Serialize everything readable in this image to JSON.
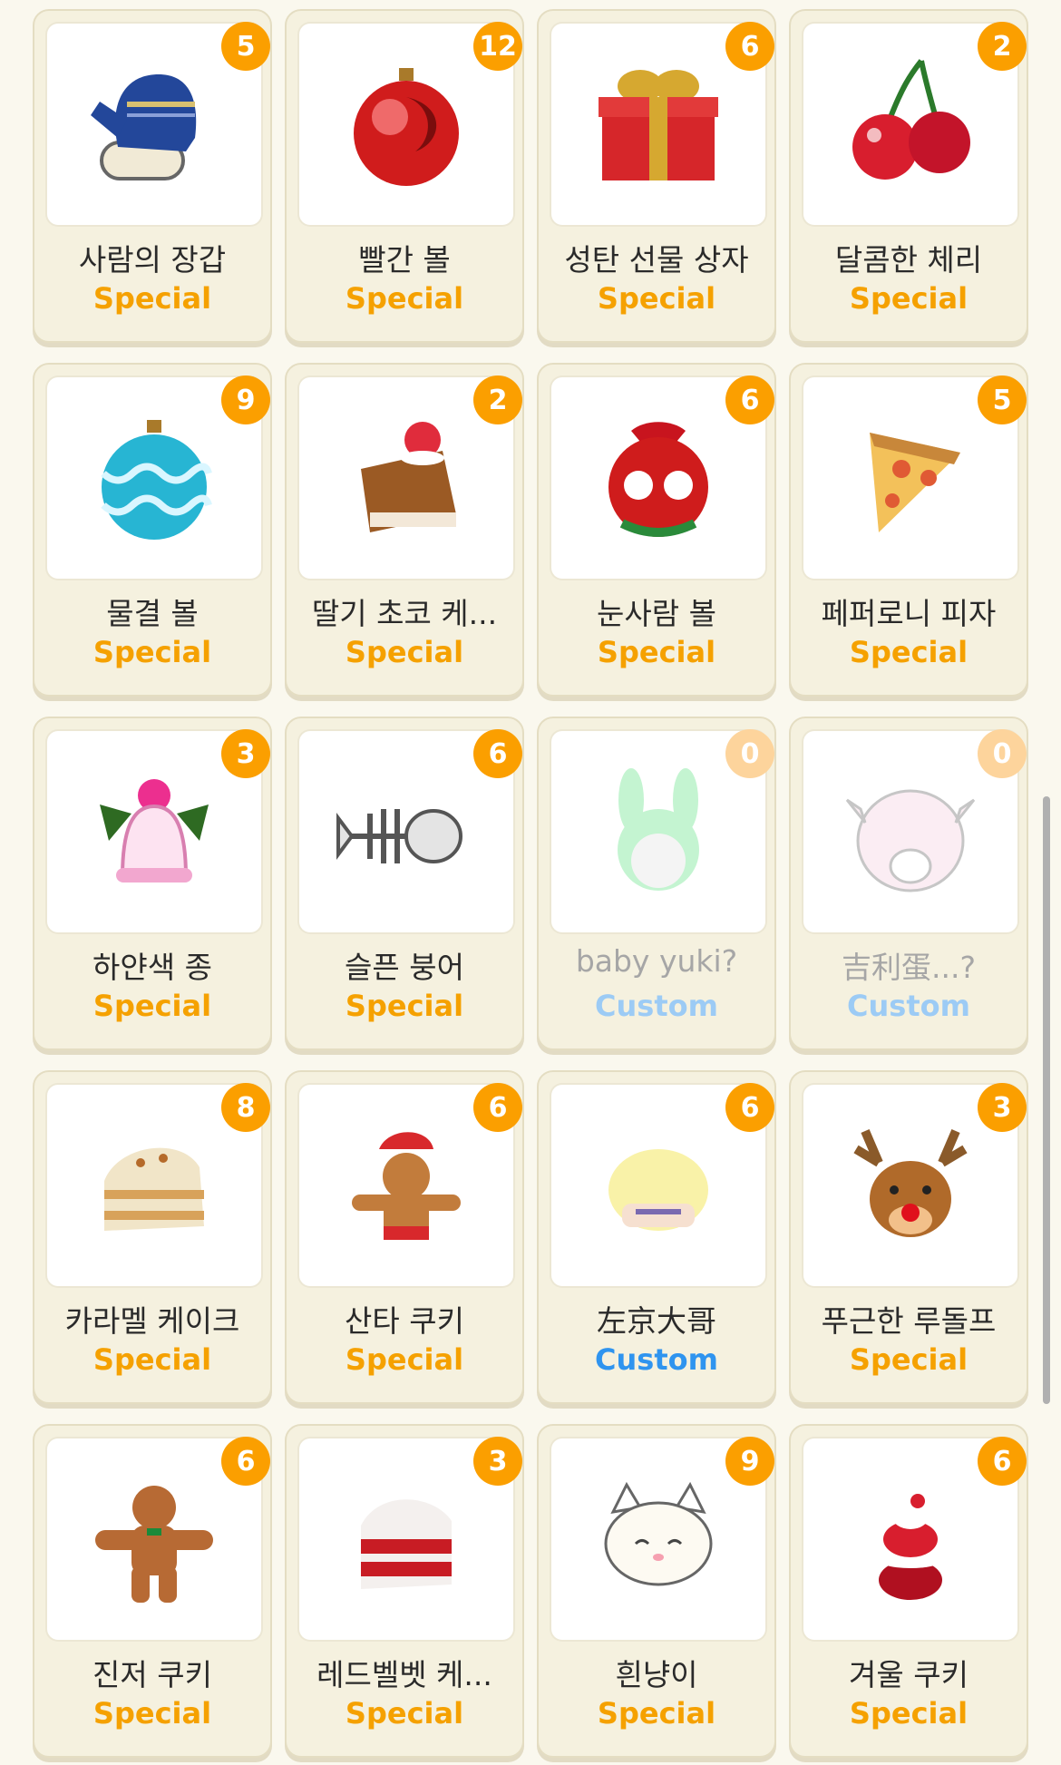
{
  "items": [
    {
      "name": "사람의 장갑",
      "type": "Special",
      "count": "5",
      "icon": "mitten-icon",
      "locked": false
    },
    {
      "name": "빨간 볼",
      "type": "Special",
      "count": "12",
      "icon": "red-ornament-icon",
      "locked": false
    },
    {
      "name": "성탄 선물 상자",
      "type": "Special",
      "count": "6",
      "icon": "gift-box-icon",
      "locked": false
    },
    {
      "name": "달콤한 체리",
      "type": "Special",
      "count": "2",
      "icon": "cherry-icon",
      "locked": false
    },
    {
      "name": "물결 볼",
      "type": "Special",
      "count": "9",
      "icon": "wave-ornament-icon",
      "locked": false
    },
    {
      "name": "딸기 초코 케...",
      "type": "Special",
      "count": "2",
      "icon": "strawberry-choco-cake-icon",
      "locked": false
    },
    {
      "name": "눈사람 볼",
      "type": "Special",
      "count": "6",
      "icon": "snowman-ornament-icon",
      "locked": false
    },
    {
      "name": "페퍼로니 피자",
      "type": "Special",
      "count": "5",
      "icon": "pizza-icon",
      "locked": false
    },
    {
      "name": "하얀색 종",
      "type": "Special",
      "count": "3",
      "icon": "bell-icon",
      "locked": false
    },
    {
      "name": "슬픈 붕어",
      "type": "Special",
      "count": "6",
      "icon": "fish-bone-icon",
      "locked": false
    },
    {
      "name": "baby yuki",
      "type": "Custom",
      "count": "0",
      "icon": "bunny-hat-icon",
      "locked": true,
      "suffix": "?"
    },
    {
      "name": "吉利蛋...",
      "type": "Custom",
      "count": "0",
      "icon": "chansey-icon",
      "locked": true,
      "suffix": "?"
    },
    {
      "name": "카라멜 케이크",
      "type": "Special",
      "count": "8",
      "icon": "caramel-cake-icon",
      "locked": false
    },
    {
      "name": "산타 쿠키",
      "type": "Special",
      "count": "6",
      "icon": "santa-cookie-icon",
      "locked": false
    },
    {
      "name": "左京大哥",
      "type": "Custom",
      "count": "6",
      "icon": "blonde-head-icon",
      "locked": false
    },
    {
      "name": "푸근한 루돌프",
      "type": "Special",
      "count": "3",
      "icon": "reindeer-icon",
      "locked": false
    },
    {
      "name": "진저 쿠키",
      "type": "Special",
      "count": "6",
      "icon": "ginger-cookie-icon",
      "locked": false
    },
    {
      "name": "레드벨벳 케...",
      "type": "Special",
      "count": "3",
      "icon": "red-velvet-cake-icon",
      "locked": false
    },
    {
      "name": "흰냥이",
      "type": "Special",
      "count": "9",
      "icon": "white-cat-icon",
      "locked": false
    },
    {
      "name": "겨울 쿠키",
      "type": "Special",
      "count": "6",
      "icon": "winter-cookie-icon",
      "locked": false
    }
  ]
}
